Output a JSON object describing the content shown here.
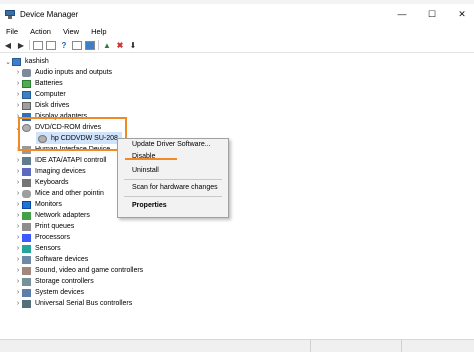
{
  "window": {
    "title": "Device Manager",
    "controls": {
      "minimize": "—",
      "maximize": "☐",
      "close": "✕"
    }
  },
  "menubar": {
    "items": [
      "File",
      "Action",
      "View",
      "Help"
    ]
  },
  "tree": {
    "root": "kashish",
    "categories": [
      "Audio inputs and outputs",
      "Batteries",
      "Computer",
      "Disk drives",
      "Display adapters",
      "DVD/CD-ROM drives",
      "Human Interface Device",
      "IDE ATA/ATAPI controll",
      "Imaging devices",
      "Keyboards",
      "Mice and other pointin",
      "Monitors",
      "Network adapters",
      "Print queues",
      "Processors",
      "Sensors",
      "Software devices",
      "Sound, video and game controllers",
      "Storage controllers",
      "System devices",
      "Universal Serial Bus controllers"
    ],
    "dvd_child": "hp CDDVDW SU-208"
  },
  "context_menu": {
    "items": [
      "Update Driver Software...",
      "Disable",
      "Uninstall",
      "Scan for hardware changes",
      "Properties"
    ]
  },
  "colors": {
    "highlight": "#f08a24",
    "selection": "#cfe4fb"
  }
}
